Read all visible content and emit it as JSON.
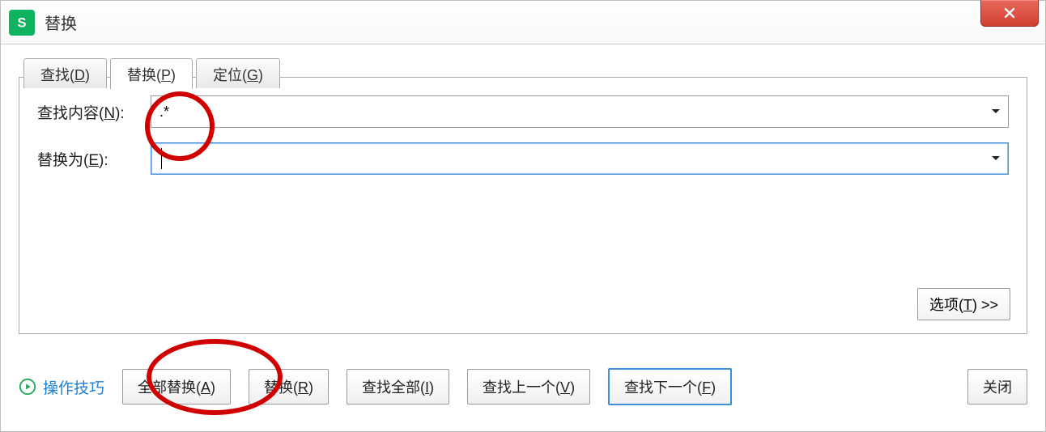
{
  "window": {
    "title": "替换"
  },
  "tabs": {
    "find": {
      "text": "查找(",
      "key": "D",
      "suffix": ")"
    },
    "replace": {
      "text": "替换(",
      "key": "P",
      "suffix": ")"
    },
    "goto": {
      "text": "定位(",
      "key": "G",
      "suffix": ")"
    }
  },
  "fields": {
    "find_label": {
      "text": "查找内容(",
      "key": "N",
      "suffix": "):"
    },
    "find_value": ".*",
    "replace_label": {
      "text": "替换为(",
      "key": "E",
      "suffix": "):"
    },
    "replace_value": ""
  },
  "options_btn": {
    "text": "选项(",
    "key": "T",
    "suffix": ") >>"
  },
  "tips_link": "操作技巧",
  "buttons": {
    "replace_all": {
      "text": "全部替换(",
      "key": "A",
      "suffix": ")"
    },
    "replace_one": {
      "text": "替换(",
      "key": "R",
      "suffix": ")"
    },
    "find_all": {
      "text": "查找全部(",
      "key": "I",
      "suffix": ")"
    },
    "find_prev": {
      "text": "查找上一个(",
      "key": "V",
      "suffix": ")"
    },
    "find_next": {
      "text": "查找下一个(",
      "key": "F",
      "suffix": ")"
    },
    "close": "关闭"
  }
}
